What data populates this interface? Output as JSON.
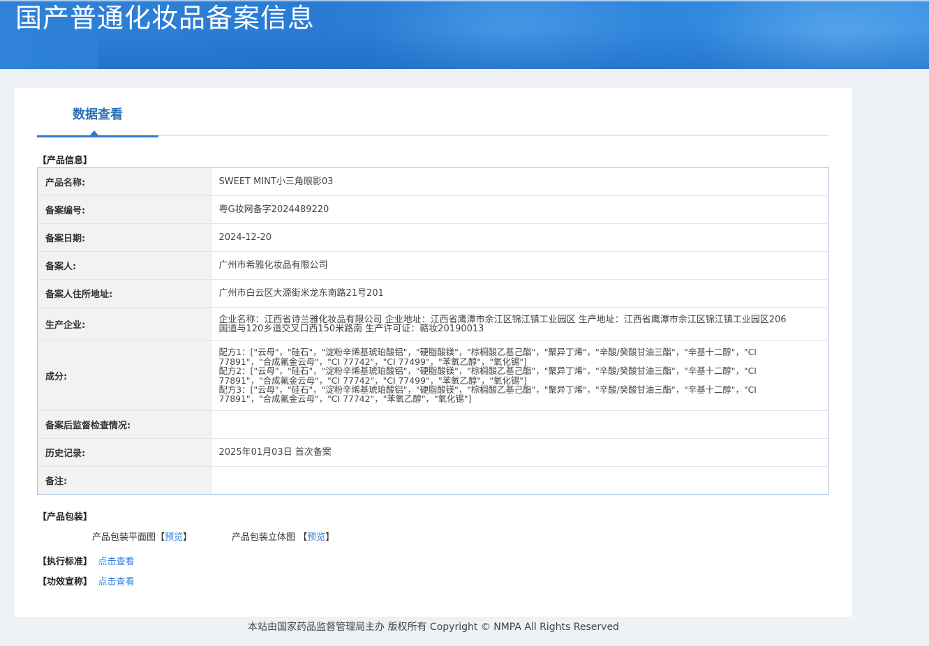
{
  "header": {
    "title": "国产普通化妆品备案信息"
  },
  "tabs": [
    {
      "label": "数据查看"
    }
  ],
  "product_info": {
    "section_title": "【产品信息】",
    "rows": [
      {
        "label": "产品名称:",
        "value": "SWEET MINT小三角眼影03"
      },
      {
        "label": "备案编号:",
        "value": "粤G妆网备字2024489220"
      },
      {
        "label": "备案日期:",
        "value": "2024-12-20"
      },
      {
        "label": "备案人:",
        "value": "广州市希雅化妆品有限公司"
      },
      {
        "label": "备案人住所地址:",
        "value": "广州市白云区大源街米龙东南路21号201"
      },
      {
        "label": "生产企业:",
        "value": "企业名称：江西省诗兰雅化妆品有限公司 企业地址：江西省鹰潭市余江区锦江镇工业园区 生产地址：江西省鹰潭市余江区锦江镇工业园区206国道与120乡道交叉口西150米路南 生产许可证：赣妆20190013"
      },
      {
        "label": "成分:",
        "value": "配方1：[\"云母\"，\"硅石\"，\"淀粉辛烯基琥珀酸铝\"，\"硬脂酸镁\"，\"棕榈酸乙基己酯\"，\"聚异丁烯\"，\"辛酸/癸酸甘油三酯\"，\"辛基十二醇\"，\"CI 77891\"，\"合成氟金云母\"，\"CI 77742\"，\"CI 77499\"，\"苯氧乙醇\"，\"氧化锡\"]\n配方2：[\"云母\"，\"硅石\"，\"淀粉辛烯基琥珀酸铝\"，\"硬脂酸镁\"，\"棕榈酸乙基己酯\"，\"聚异丁烯\"，\"辛酸/癸酸甘油三酯\"，\"辛基十二醇\"，\"CI 77891\"，\"合成氟金云母\"，\"CI 77742\"，\"CI 77499\"，\"苯氧乙醇\"，\"氧化锡\"]\n配方3：[\"云母\"，\"硅石\"，\"淀粉辛烯基琥珀酸铝\"，\"硬脂酸镁\"，\"棕榈酸乙基己酯\"，\"聚异丁烯\"，\"辛酸/癸酸甘油三酯\"，\"辛基十二醇\"，\"CI 77891\"，\"合成氟金云母\"，\"CI 77742\"，\"苯氧乙醇\"，\"氧化锡\"]"
      },
      {
        "label": "备案后监督检查情况:",
        "value": ""
      },
      {
        "label": "历史记录:",
        "value": "2025年01月03日 首次备案"
      },
      {
        "label": "备注:",
        "value": ""
      }
    ]
  },
  "packaging": {
    "section_title": "【产品包装】",
    "flat_label": "产品包装平面图",
    "solid_label": "产品包装立体图",
    "preview_link": "预览",
    "bracket_open": "【",
    "bracket_close": "】"
  },
  "standard": {
    "section_title": "【执行标准】",
    "link": "点击查看"
  },
  "efficacy": {
    "section_title": "【功效宣称】",
    "link": "点击查看"
  },
  "footer": {
    "text": "本站由国家药品监督管理局主办 版权所有 Copyright © NMPA All Rights Reserved"
  }
}
